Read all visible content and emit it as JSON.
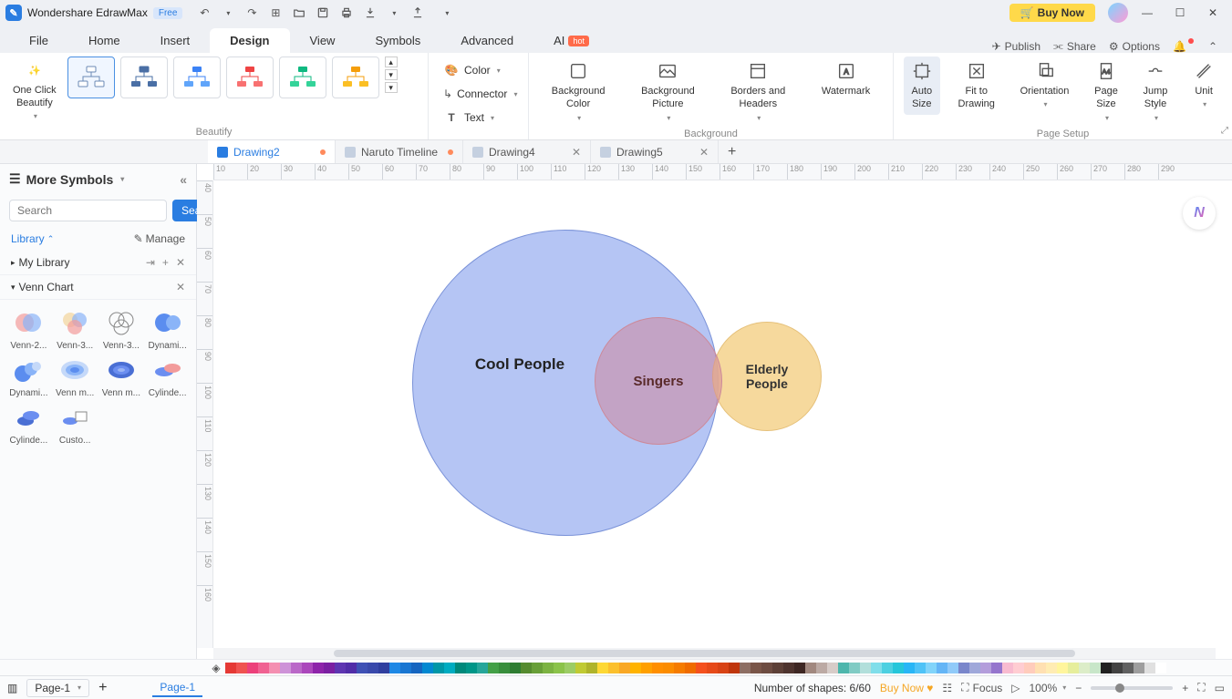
{
  "app": {
    "name": "Wondershare EdrawMax",
    "badge": "Free",
    "buy": "Buy Now"
  },
  "menu": {
    "tabs": [
      "File",
      "Home",
      "Insert",
      "Design",
      "View",
      "Symbols",
      "Advanced"
    ],
    "ai": "AI",
    "hot": "hot",
    "right": {
      "publish": "Publish",
      "share": "Share",
      "options": "Options"
    }
  },
  "ribbon": {
    "beautify": {
      "btn": "One Click\nBeautify",
      "group": "Beautify"
    },
    "color": "Color",
    "connector": "Connector",
    "text": "Text",
    "bgcolor": "Background\nColor",
    "bgpic": "Background\nPicture",
    "borders": "Borders and\nHeaders",
    "watermark": "Watermark",
    "bgGroup": "Background",
    "autosize": "Auto\nSize",
    "fit": "Fit to\nDrawing",
    "orientation": "Orientation",
    "pagesize": "Page\nSize",
    "jumpstyle": "Jump\nStyle",
    "unit": "Unit",
    "setupGroup": "Page Setup"
  },
  "docs": [
    {
      "name": "Drawing2",
      "dirty": true,
      "active": true
    },
    {
      "name": "Naruto Timeline",
      "dirty": true,
      "active": false
    },
    {
      "name": "Drawing4",
      "dirty": false,
      "active": false
    },
    {
      "name": "Drawing5",
      "dirty": false,
      "active": false
    }
  ],
  "side": {
    "more": "More Symbols",
    "searchPlaceholder": "Search",
    "searchBtn": "Search",
    "library": "Library",
    "manage": "Manage",
    "mylib": "My Library",
    "venn": "Venn Chart",
    "items": [
      "Venn-2...",
      "Venn-3...",
      "Venn-3...",
      "Dynami...",
      "Dynami...",
      "Venn m...",
      "Venn m...",
      "Cylinde...",
      "Cylinde...",
      "Custo..."
    ]
  },
  "hruler": [
    "10",
    "20",
    "30",
    "40",
    "50",
    "60",
    "70",
    "80",
    "90",
    "100",
    "110",
    "120",
    "130",
    "140",
    "150",
    "160",
    "170",
    "180",
    "190",
    "200",
    "210",
    "220",
    "230",
    "240",
    "250",
    "260",
    "270",
    "280",
    "290"
  ],
  "vruler": [
    "40",
    "50",
    "60",
    "70",
    "80",
    "90",
    "100",
    "110",
    "120",
    "130",
    "140",
    "150",
    "160"
  ],
  "venn": {
    "cool": "Cool People",
    "singers": "Singers",
    "elderly": "Elderly\nPeople"
  },
  "colors": [
    "#e53935",
    "#ef5350",
    "#ec407a",
    "#f06292",
    "#f48fb1",
    "#ce93d8",
    "#ba68c8",
    "#ab47bc",
    "#8e24aa",
    "#7b1fa2",
    "#5e35b1",
    "#512da8",
    "#3f51b5",
    "#3949ab",
    "#303f9f",
    "#1e88e5",
    "#1976d2",
    "#1565c0",
    "#0288d1",
    "#0097a7",
    "#00acc1",
    "#00897b",
    "#009688",
    "#26a69a",
    "#43a047",
    "#388e3c",
    "#2e7d32",
    "#558b2f",
    "#689f38",
    "#7cb342",
    "#8bc34a",
    "#9ccc65",
    "#c0ca33",
    "#afb42b",
    "#fdd835",
    "#fbc02d",
    "#f9a825",
    "#ffb300",
    "#ffa000",
    "#ff8f00",
    "#fb8c00",
    "#f57c00",
    "#ef6c00",
    "#f4511e",
    "#e64a19",
    "#d84315",
    "#bf360c",
    "#8d6e63",
    "#795548",
    "#6d4c41",
    "#5d4037",
    "#4e342e",
    "#3e2723",
    "#a1887f",
    "#bcaaa4",
    "#d7ccc8",
    "#4db6ac",
    "#80cbc4",
    "#b2dfdb",
    "#80deea",
    "#4dd0e1",
    "#26c6da",
    "#29b6f6",
    "#4fc3f7",
    "#81d4fa",
    "#64b5f6",
    "#90caf9",
    "#7986cb",
    "#9fa8da",
    "#b39ddb",
    "#9575cd",
    "#f8bbd0",
    "#ffcdd2",
    "#ffccbc",
    "#ffe0b2",
    "#ffecb3",
    "#fff59d",
    "#e6ee9c",
    "#dcedc8",
    "#c8e6c9",
    "#212121",
    "#424242",
    "#616161",
    "#9e9e9e",
    "#e0e0e0",
    "#ffffff"
  ],
  "status": {
    "page": "Page-1",
    "pageTab": "Page-1",
    "shapes": "Number of shapes: 6/60",
    "buy": "Buy Now",
    "focus": "Focus",
    "zoom": "100%"
  }
}
